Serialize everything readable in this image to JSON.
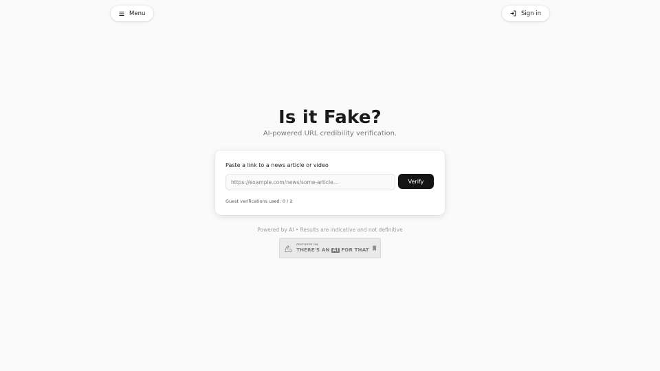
{
  "header": {
    "menu_label": "Menu",
    "menu_icon": "hamburger-icon",
    "signin_label": "Sign in",
    "signin_icon": "sign-in-icon"
  },
  "hero": {
    "title": "Is it Fake?",
    "subtitle": "AI-powered URL credibility verification."
  },
  "card": {
    "label": "Paste a link to a news article or video",
    "input_placeholder": "https://example.com/news/some-article...",
    "input_value": "",
    "verify_label": "Verify",
    "guest_usage": "Guest verifications used: 0 / 2"
  },
  "footer": {
    "note": "Powered by AI • Results are indicative and not definitive",
    "badge": {
      "small_text": "FEATURED ON",
      "big_text_before": "THERE'S AN",
      "big_text_ai": "AI",
      "big_text_after": "FOR THAT",
      "logo_icon": "flexed-arm-icon",
      "bookmark_icon": "bookmark-icon"
    }
  },
  "colors": {
    "background": "#fafafa",
    "primary_button": "#141414",
    "text_primary": "#1a1a1a",
    "text_muted": "#7a7a7a"
  }
}
